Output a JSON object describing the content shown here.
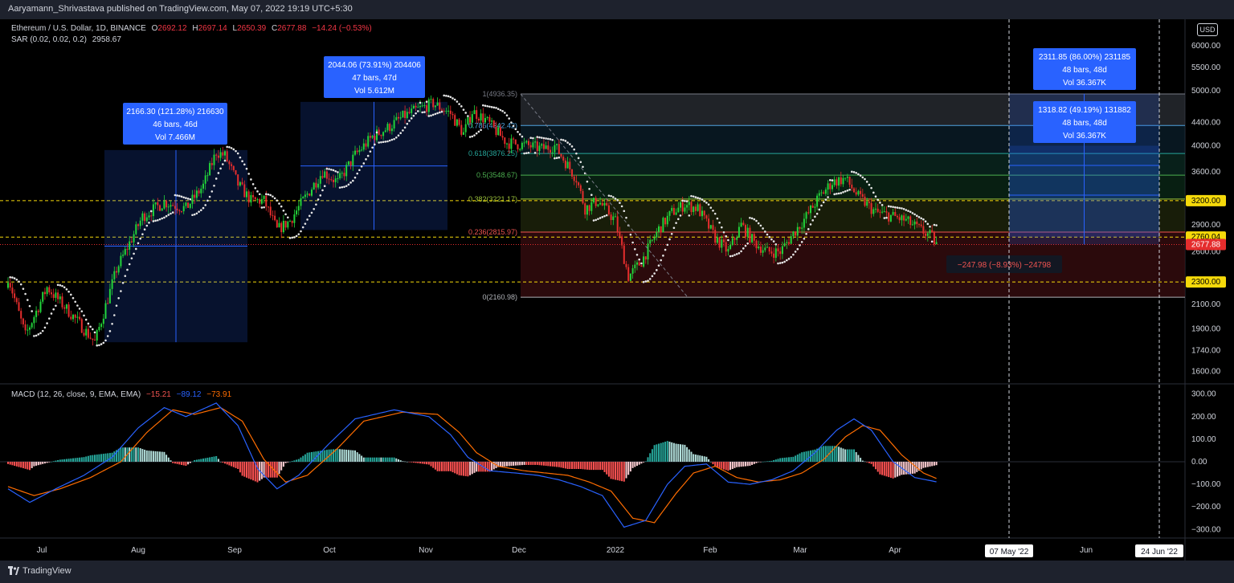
{
  "header": {
    "published": "Aaryamann_Shrivastava published on TradingView.com, May 07, 2022 19:19 UTC+5:30"
  },
  "footer": {
    "brand": "TradingView"
  },
  "legend": {
    "symbol": "Ethereum / U.S. Dollar, 1D, BINANCE",
    "o_label": "O",
    "o_value": "2692.12",
    "h_label": "H",
    "h_value": "2697.14",
    "l_label": "L",
    "l_value": "2650.39",
    "c_label": "C",
    "c_value": "2677.88",
    "change": "−14.24 (−0.53%)",
    "sar_label": "SAR (0.02, 0.02, 0.2)",
    "sar_value": "2958.67",
    "macd_label": "MACD (12, 26, close, 9, EMA, EMA)",
    "macd_hist": "−15.21",
    "macd_line": "−89.12",
    "macd_signal": "−73.91"
  },
  "currency": "USD",
  "colors": {
    "up": "#26a69a",
    "down": "#ef5350",
    "bull_candle": "#22d43a",
    "bear_candle": "#e52d2d",
    "accent_blue": "#2962ff",
    "fib_yellow": "#f5d90a",
    "macd_line": "#2962ff",
    "macd_signal": "#ff6d00"
  },
  "chart_data": [
    {
      "type": "candlestick",
      "title": "Ethereum / U.S. Dollar, 1D, BINANCE",
      "x_tick_labels": [
        "Jul",
        "Aug",
        "Sep",
        "Oct",
        "Nov",
        "Dec",
        "2022",
        "Feb",
        "Mar",
        "Apr",
        "May",
        "Jun"
      ],
      "y_scale": "log",
      "ylim": [
        1520,
        6600
      ],
      "y_tick_labels": [
        "6000.00",
        "5500.00",
        "5000.00",
        "4400.00",
        "4000.00",
        "3600.00",
        "2900.00",
        "2600.00",
        "2100.00",
        "1900.00",
        "1740.00",
        "1600.00"
      ],
      "price_labels": [
        {
          "value": "3200.00",
          "style": "yellow"
        },
        {
          "value": "2760.04",
          "style": "yellow"
        },
        {
          "value": "2677.88",
          "style": "red"
        },
        {
          "value": "2300.00",
          "style": "yellow"
        }
      ],
      "horizontal_lines": [
        3200,
        2760,
        2300
      ],
      "fib_retracement": {
        "high": 4936.35,
        "low": 2160.98,
        "levels": [
          {
            "ratio": "1",
            "price": "4936.35"
          },
          {
            "ratio": "0.786",
            "price": "4342.42"
          },
          {
            "ratio": "0.618",
            "price": "3876.25"
          },
          {
            "ratio": "0.5",
            "price": "3548.67"
          },
          {
            "ratio": "0.382",
            "price": "3221.17"
          },
          {
            "ratio": "0.236",
            "price": "2815.97"
          },
          {
            "ratio": "0",
            "price": "2160.98"
          }
        ]
      },
      "measurements": [
        {
          "line1": "2166.30 (121.28%) 216630",
          "line2": "46 bars, 46d",
          "line3": "Vol 7.466M"
        },
        {
          "line1": "2044.06 (73.91%) 204406",
          "line2": "47 bars, 47d",
          "line3": "Vol 5.612M"
        },
        {
          "line1": "2311.85 (86.00%) 231185",
          "line2": "48 bars, 48d",
          "line3": "Vol 36.367K"
        },
        {
          "line1": "1318.82 (49.19%) 131882",
          "line2": "48 bars, 48d",
          "line3": "Vol 36.367K"
        }
      ],
      "negative_measure": "−247.98 (−8.93%) −24798",
      "date_markers": [
        "07 May '22",
        "24 Jun '22"
      ],
      "price_path": [
        [
          0,
          2350
        ],
        [
          8,
          1850
        ],
        [
          18,
          2250
        ],
        [
          30,
          2000
        ],
        [
          40,
          1800
        ],
        [
          50,
          2420
        ],
        [
          62,
          3000
        ],
        [
          72,
          3180
        ],
        [
          82,
          3100
        ],
        [
          90,
          3400
        ],
        [
          96,
          3900
        ],
        [
          100,
          3840
        ],
        [
          106,
          3420
        ],
        [
          112,
          3200
        ],
        [
          118,
          3200
        ],
        [
          124,
          2840
        ],
        [
          130,
          2950
        ],
        [
          136,
          3200
        ],
        [
          145,
          3600
        ],
        [
          152,
          3450
        ],
        [
          160,
          3850
        ],
        [
          168,
          4150
        ],
        [
          175,
          4300
        ],
        [
          182,
          4500
        ],
        [
          188,
          4620
        ],
        [
          196,
          4750
        ],
        [
          204,
          4560
        ],
        [
          210,
          4200
        ],
        [
          214,
          4600
        ],
        [
          220,
          4450
        ],
        [
          230,
          4050
        ],
        [
          240,
          4000
        ],
        [
          246,
          3950
        ],
        [
          252,
          4000
        ],
        [
          262,
          3500
        ],
        [
          266,
          3100
        ],
        [
          272,
          3200
        ],
        [
          280,
          2950
        ],
        [
          286,
          2350
        ],
        [
          292,
          2500
        ],
        [
          300,
          2850
        ],
        [
          306,
          3050
        ],
        [
          312,
          3150
        ],
        [
          318,
          3100
        ],
        [
          326,
          2750
        ],
        [
          332,
          2600
        ],
        [
          338,
          2900
        ],
        [
          344,
          2700
        ],
        [
          350,
          2600
        ],
        [
          356,
          2600
        ],
        [
          362,
          2800
        ],
        [
          368,
          3000
        ],
        [
          374,
          3250
        ],
        [
          380,
          3450
        ],
        [
          386,
          3500
        ],
        [
          392,
          3250
        ],
        [
          400,
          3050
        ],
        [
          408,
          3000
        ],
        [
          414,
          2950
        ],
        [
          420,
          2850
        ],
        [
          426,
          2760
        ],
        [
          428,
          2678
        ]
      ]
    },
    {
      "type": "macd",
      "title": "MACD (12, 26, close, 9, EMA, EMA)",
      "ylim": [
        -350,
        350
      ],
      "y_tick_labels": [
        "300.00",
        "200.00",
        "100.00",
        "0.00",
        "−100.00",
        "−200.00",
        "−300.00"
      ],
      "macd_path": [
        [
          0,
          -120
        ],
        [
          10,
          -180
        ],
        [
          22,
          -120
        ],
        [
          35,
          -60
        ],
        [
          48,
          20
        ],
        [
          60,
          150
        ],
        [
          72,
          240
        ],
        [
          82,
          200
        ],
        [
          96,
          260
        ],
        [
          106,
          160
        ],
        [
          115,
          -30
        ],
        [
          124,
          -120
        ],
        [
          134,
          -60
        ],
        [
          148,
          80
        ],
        [
          160,
          190
        ],
        [
          178,
          230
        ],
        [
          194,
          200
        ],
        [
          204,
          120
        ],
        [
          212,
          20
        ],
        [
          222,
          -40
        ],
        [
          234,
          -50
        ],
        [
          244,
          -60
        ],
        [
          254,
          -80
        ],
        [
          264,
          -110
        ],
        [
          274,
          -150
        ],
        [
          284,
          -290
        ],
        [
          294,
          -260
        ],
        [
          304,
          -100
        ],
        [
          312,
          -20
        ],
        [
          322,
          -10
        ],
        [
          332,
          -90
        ],
        [
          342,
          -100
        ],
        [
          352,
          -80
        ],
        [
          362,
          -40
        ],
        [
          372,
          40
        ],
        [
          382,
          140
        ],
        [
          390,
          190
        ],
        [
          398,
          140
        ],
        [
          408,
          0
        ],
        [
          418,
          -70
        ],
        [
          428,
          -89
        ]
      ],
      "signal_path": [
        [
          0,
          -110
        ],
        [
          12,
          -150
        ],
        [
          24,
          -120
        ],
        [
          38,
          -70
        ],
        [
          52,
          0
        ],
        [
          64,
          130
        ],
        [
          76,
          230
        ],
        [
          86,
          210
        ],
        [
          98,
          240
        ],
        [
          108,
          180
        ],
        [
          118,
          10
        ],
        [
          128,
          -90
        ],
        [
          138,
          -60
        ],
        [
          152,
          60
        ],
        [
          164,
          180
        ],
        [
          182,
          220
        ],
        [
          198,
          210
        ],
        [
          208,
          130
        ],
        [
          216,
          40
        ],
        [
          226,
          -20
        ],
        [
          238,
          -40
        ],
        [
          248,
          -50
        ],
        [
          258,
          -60
        ],
        [
          268,
          -90
        ],
        [
          278,
          -130
        ],
        [
          288,
          -250
        ],
        [
          298,
          -270
        ],
        [
          308,
          -140
        ],
        [
          316,
          -50
        ],
        [
          326,
          -20
        ],
        [
          336,
          -70
        ],
        [
          346,
          -90
        ],
        [
          356,
          -80
        ],
        [
          366,
          -50
        ],
        [
          376,
          10
        ],
        [
          386,
          110
        ],
        [
          394,
          160
        ],
        [
          402,
          140
        ],
        [
          412,
          30
        ],
        [
          422,
          -50
        ],
        [
          428,
          -74
        ]
      ]
    }
  ]
}
